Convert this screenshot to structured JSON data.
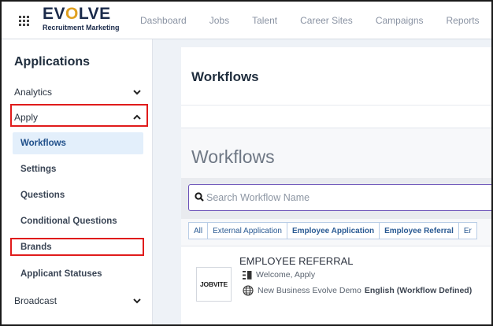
{
  "header": {
    "logo_main": "EV",
    "logo_o": "O",
    "logo_rest": "LVE",
    "logo_sub": "Recruitment Marketing",
    "nav": [
      "Dashboard",
      "Jobs",
      "Talent",
      "Career Sites",
      "Campaigns",
      "Reports"
    ]
  },
  "sidebar": {
    "title": "Applications",
    "analytics": "Analytics",
    "apply": "Apply",
    "items": [
      "Workflows",
      "Settings",
      "Questions",
      "Conditional Questions",
      "Brands",
      "Applicant Statuses"
    ],
    "broadcast": "Broadcast"
  },
  "main": {
    "title": "Workflows",
    "heading": "Workflows",
    "search": {
      "placeholder": "Search Workflow Name",
      "value": ""
    },
    "filters": [
      "All",
      "External Application",
      "Employee Application",
      "Employee Referral",
      "Er"
    ],
    "workflow": {
      "title": "EMPLOYEE REFERRAL",
      "logo_text": "JOBVITE",
      "step": "Welcome, Apply",
      "brand": "New Business Evolve Demo",
      "language": "English (Workflow Defined)"
    }
  },
  "colors": {
    "highlight": "#e01b1b",
    "accent": "#6a50b8",
    "active_bg": "#e3effb",
    "logo_o": "#e0a020"
  },
  "icons": {
    "apps": "grid-icon",
    "search": "search-icon",
    "step": "list-icon",
    "brand": "globe-icon",
    "expand": "chevron-down-icon",
    "collapse": "chevron-up-icon"
  }
}
